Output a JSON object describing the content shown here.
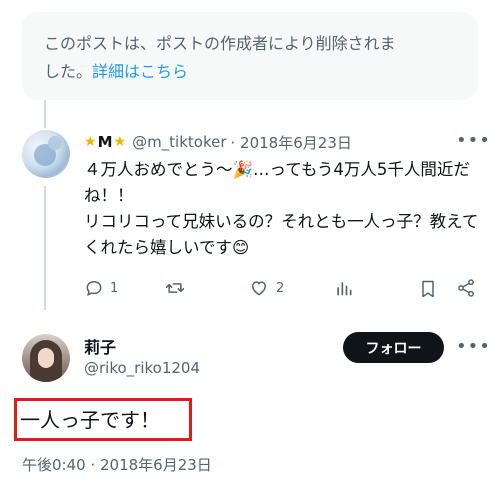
{
  "notice": {
    "line1": "このポストは、ポストの作成者により削除されま",
    "line2_prefix": "した。",
    "link": "詳細はこちら"
  },
  "post1": {
    "name_letter": "M",
    "star_left": "★",
    "star_right": "★",
    "handle": "@m_tiktoker",
    "date": "· 2018年6月23日",
    "body": "４万人おめでとう〜🎉…ってもう4万人5千人間近だね！！\nリコリコって兄妹いるの？それとも一人っ子？教えてくれたら嬉しいです😊",
    "reply_count": "1",
    "retweet_count": "",
    "like_count": "2"
  },
  "post2": {
    "name": "莉子",
    "handle": "@riko_riko1204",
    "follow_label": "フォロー",
    "text": "一人っ子です！",
    "timestamp": "午後0:40 · 2018年6月23日"
  },
  "colors": {
    "accent": "#1d9bf0",
    "muted": "#536471",
    "highlight": "#e01b1b"
  }
}
